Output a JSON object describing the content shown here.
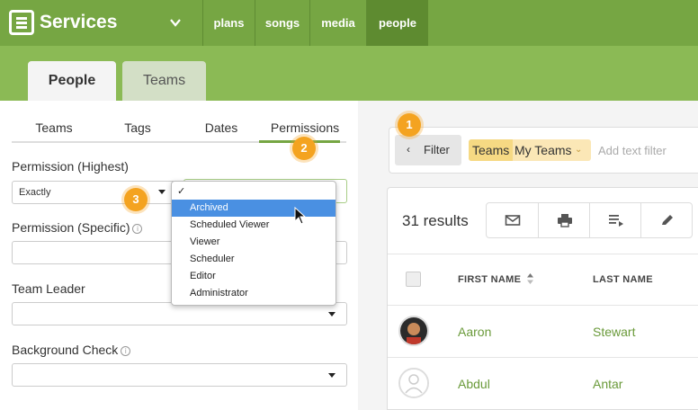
{
  "app": {
    "name": "Services"
  },
  "nav": {
    "items": [
      {
        "label": "plans",
        "active": false
      },
      {
        "label": "songs",
        "active": false
      },
      {
        "label": "media",
        "active": false
      },
      {
        "label": "people",
        "active": true
      }
    ]
  },
  "page_tabs": [
    {
      "label": "People",
      "active": true
    },
    {
      "label": "Teams",
      "active": false
    }
  ],
  "filter_tabs": [
    {
      "label": "Teams",
      "active": false
    },
    {
      "label": "Tags",
      "active": false
    },
    {
      "label": "Dates",
      "active": false
    },
    {
      "label": "Permissions",
      "active": true
    }
  ],
  "fields": {
    "permission_highest": {
      "label": "Permission (Highest)",
      "comparator": "Exactly"
    },
    "permission_specific": {
      "label": "Permission (Specific)",
      "info": "i"
    },
    "team_leader": {
      "label": "Team Leader"
    },
    "background_check": {
      "label": "Background Check",
      "info": "i"
    }
  },
  "dropdown": {
    "check": "✓",
    "items": [
      "Archived",
      "Scheduled Viewer",
      "Viewer",
      "Scheduler",
      "Editor",
      "Administrator"
    ],
    "highlighted": "Archived"
  },
  "steps": [
    "1",
    "2",
    "3"
  ],
  "filter": {
    "button_label": "Filter",
    "chevron": "‹",
    "chip_key": "Teams",
    "chip_value": "My Teams",
    "chip_caret": "⌄",
    "text_placeholder": "Add text filter"
  },
  "results": {
    "count_label": "31 results",
    "tools": [
      "envelope-icon",
      "printer-icon",
      "list-icon",
      "pencil-icon"
    ],
    "columns": [
      "FIRST NAME",
      "LAST NAME"
    ],
    "rows": [
      {
        "first": "Aaron",
        "last": "Stewart",
        "avatar": "photo"
      },
      {
        "first": "Abdul",
        "last": "Antar",
        "avatar": "placeholder"
      }
    ]
  },
  "colors": {
    "brand": "#76a643",
    "brand_light": "#8bba55",
    "highlight": "#4a90e2",
    "badge": "#f4a320",
    "link": "#6a9a3a"
  }
}
